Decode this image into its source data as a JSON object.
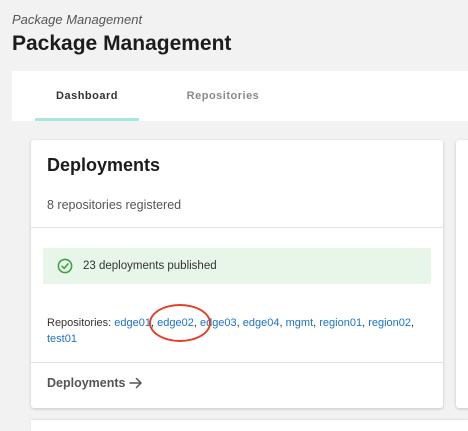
{
  "header": {
    "breadcrumb": "Package Management",
    "title": "Package Management"
  },
  "tabs": [
    {
      "label": "Dashboard",
      "active": true
    },
    {
      "label": "Repositories",
      "active": false
    }
  ],
  "deployments_card": {
    "title": "Deployments",
    "subtitle": "8 repositories registered",
    "status": {
      "icon": "check-circle-icon",
      "text": "23 deployments published",
      "color": "#43a047"
    },
    "repositories_label": "Repositories:",
    "repositories": [
      "edge01",
      "edge02",
      "edge03",
      "edge04",
      "mgmt",
      "region01",
      "region02",
      "test01"
    ],
    "footer_link": "Deployments",
    "footer_icon": "arrow-right-icon"
  },
  "colors": {
    "accent_underline": "#a7e8dd",
    "link": "#1a73c9",
    "highlight_ring": "#e0422a",
    "status_bg": "#e8f5e9"
  }
}
